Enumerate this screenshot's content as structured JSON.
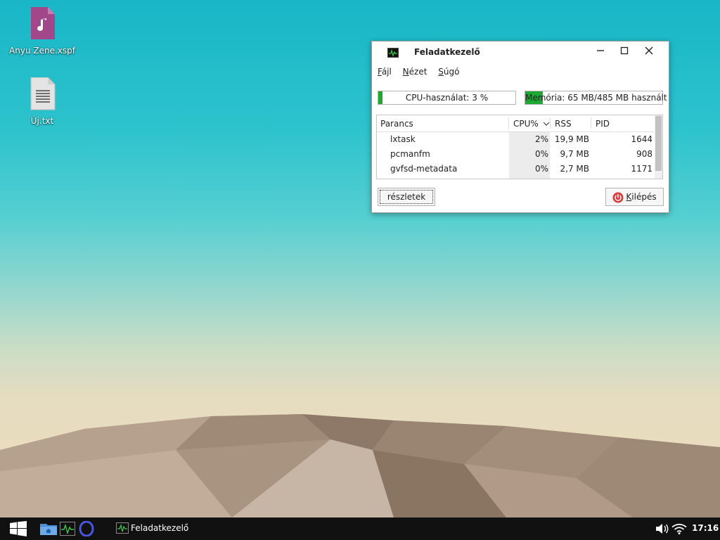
{
  "desktop": {
    "icons": [
      {
        "label": "Anyu Zene.xspf",
        "icon": "music-file-icon"
      },
      {
        "label": "Új.txt",
        "icon": "text-file-icon"
      }
    ]
  },
  "window": {
    "title": "Feladatkezelő",
    "menu": [
      {
        "label": "Fájl",
        "mnemonic": "F",
        "rest": "ájl"
      },
      {
        "label": "Nézet",
        "mnemonic": "N",
        "rest": "ézet"
      },
      {
        "label": "Súgó",
        "mnemonic": "S",
        "rest": "úgó"
      }
    ],
    "cpu": {
      "label": "CPU-használat: 3 %",
      "percent": 3
    },
    "memory": {
      "label": "Memória: 65 MB/485 MB használt",
      "used_mb": 65,
      "total_mb": 485
    },
    "table": {
      "columns": {
        "command": "Parancs",
        "cpu": "CPU%",
        "rss": "RSS",
        "pid": "PID"
      },
      "rows": [
        {
          "command": "lxtask",
          "cpu": "2%",
          "rss": "19,9 MB",
          "pid": "1644"
        },
        {
          "command": "pcmanfm",
          "cpu": "0%",
          "rss": "9,7 MB",
          "pid": "908"
        },
        {
          "command": "gvfsd-metadata",
          "cpu": "0%",
          "rss": "2,7 MB",
          "pid": "1171"
        }
      ]
    },
    "buttons": {
      "details": "részletek",
      "quit": "Kilépés",
      "quit_mnemonic": "K",
      "quit_rest": "ilépés"
    }
  },
  "taskbar": {
    "task": "Feladatkezelő",
    "clock": "17:16"
  },
  "colors": {
    "accent_green": "#1fa733",
    "quit_red": "#d93a3a"
  }
}
